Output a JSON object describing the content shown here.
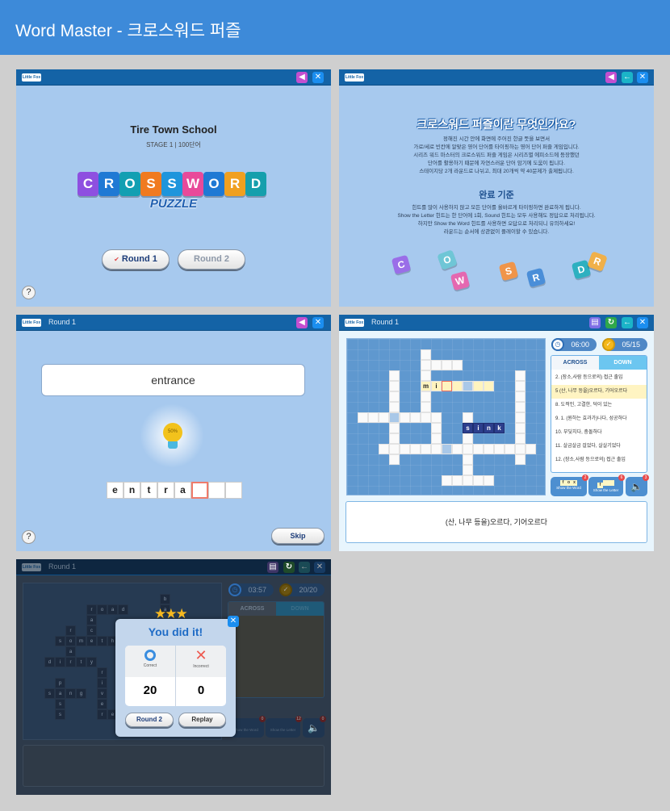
{
  "app_title": "Word Master - 크로스워드 퍼즐",
  "logo": "Little Fox",
  "colors": {
    "accent": "#3d8ad9",
    "bar": "#1463a6",
    "panel_bg": "#a7c9ee"
  },
  "intro": {
    "title": "Tire Town School",
    "stage": "STAGE 1 | 100단어",
    "logo_letters": [
      "C",
      "R",
      "O",
      "S",
      "S",
      "W",
      "O",
      "R",
      "D"
    ],
    "logo_colors": [
      "#8e4fe0",
      "#1f79d4",
      "#129fb2",
      "#f07a20",
      "#1e95dc",
      "#e84a9a",
      "#1f79d4",
      "#f0a020",
      "#159fac"
    ],
    "subtitle": "PUZZLE",
    "round1": "Round 1",
    "round2": "Round 2",
    "check": "✔",
    "help": "?"
  },
  "about": {
    "title": "크로스워드 퍼즐이란 무엇인가요?",
    "lines": [
      "정해진 시간 안에 화면에 주어진 한글 뜻을 보면서",
      "가로/세로 빈칸에 알맞은 영어 단어를 타이핑하는 영어 단어 퍼즐 게임입니다.",
      "시리즈 워드 마스터의 크로스워드 퍼즐 게임은 시리즈별 에피소드에 등장했던",
      "단어를 활용하기 때문에 자연스러운 단어 암기에 도움이 됩니다.",
      "스테이지당 2개 라운드로 나뉘고, 최대 20개씩 약 40문제가 출제됩니다."
    ],
    "title2": "완료 기준",
    "lines2": [
      "힌트를 많이 사용하지 않고 모든 단어를 올바르게 타이핑하면 완료하게 됩니다.",
      "Show the Letter 힌트는 한 단어에 1회, Sound 힌트는 모두 사용해도 정답으로 처리됩니다.",
      "하지만 Show the Word 힌트를 사용하면 오답으로 처리되니 유의하세요!",
      "라운드는 순서에 상관없이 플레이할 수 있습니다."
    ],
    "tiles": [
      "C",
      "O",
      "W",
      "S",
      "R",
      "D",
      "R"
    ]
  },
  "quiz": {
    "round": "Round 1",
    "word": "entrance",
    "hint_percent": "50%",
    "letters": [
      "e",
      "n",
      "t",
      "r",
      "a",
      "",
      "",
      ""
    ],
    "cursor_index": 5,
    "skip": "Skip",
    "help": "?"
  },
  "game": {
    "round": "Round 1",
    "time": "06:00",
    "progress": "05/15",
    "tab_across": "ACROSS",
    "tab_down": "DOWN",
    "clues": [
      "2. (장소,사람 등으로의) 접근 출입",
      "5 (산, 나무 등을)오르다, 기어오르다",
      "8. 도적인, 고결한, 덕이 있는",
      "9. 1. (원하는 효과가)나다, 성공하다",
      "10. 부딪치다, 충돌하다",
      "11. 살금살금 걸었다, 살살기었다",
      "12. (장소,사람 등으로의) 접근 출입"
    ],
    "selected_clue": 1,
    "hint_word": {
      "label": "Show the Word",
      "sample": [
        "f",
        "o",
        "x"
      ],
      "count": "2"
    },
    "hint_letter": {
      "label": "Show the Letter",
      "sample": [
        "f",
        "",
        ""
      ],
      "count": "6"
    },
    "hint_sound": {
      "count": "3"
    },
    "current_clue": "(산, 나무 등을)오르다, 기어오르다",
    "words": [
      {
        "r": 1,
        "c": 7,
        "dir": "down",
        "len": 7
      },
      {
        "r": 2,
        "c": 7,
        "dir": "across",
        "len": 4
      },
      {
        "r": 4,
        "c": 7,
        "dir": "across",
        "len": 7,
        "letters": "mi",
        "state": "active"
      },
      {
        "r": 3,
        "c": 4,
        "dir": "down",
        "len": 9
      },
      {
        "r": 7,
        "c": 1,
        "dir": "across",
        "len": 8
      },
      {
        "r": 7,
        "c": 8,
        "dir": "down",
        "len": 4
      },
      {
        "r": 8,
        "c": 11,
        "dir": "across",
        "len": 4,
        "letters": "sink",
        "state": "solved"
      },
      {
        "r": 7,
        "c": 11,
        "dir": "down",
        "len": 7
      },
      {
        "r": 10,
        "c": 3,
        "dir": "across",
        "len": 15
      },
      {
        "r": 3,
        "c": 16,
        "dir": "down",
        "len": 9
      },
      {
        "r": 13,
        "c": 9,
        "dir": "across",
        "len": 5
      }
    ],
    "cursor": {
      "r": 4,
      "c": 9
    },
    "hint_cells": [
      {
        "r": 4,
        "c": 11
      },
      {
        "r": 7,
        "c": 4
      },
      {
        "r": 10,
        "c": 9
      }
    ]
  },
  "result": {
    "round": "Round 1",
    "time": "03:57",
    "progress": "20/20",
    "tab_across": "ACROSS",
    "tab_down": "DOWN",
    "title": "You did it!",
    "correct_label": "Correct",
    "incorrect_label": "Incorrect",
    "correct": "20",
    "incorrect": "0",
    "round2": "Round 2",
    "replay": "Replay",
    "hint_word_count": "0",
    "hint_letter_count": "12",
    "hint_sound_count": "0",
    "hint_word": "Show the Word",
    "hint_letter": "Show the Letter",
    "words": [
      {
        "r": 1,
        "c": 13,
        "dir": "down",
        "text": "ba"
      },
      {
        "r": 2,
        "c": 6,
        "dir": "across",
        "text": "road"
      },
      {
        "r": 2,
        "c": 6,
        "dir": "down",
        "text": "race"
      },
      {
        "r": 4,
        "c": 4,
        "dir": "down",
        "text": "roar"
      },
      {
        "r": 5,
        "c": 3,
        "dir": "across",
        "text": "someth"
      },
      {
        "r": 7,
        "c": 2,
        "dir": "across",
        "text": "dirty"
      },
      {
        "r": 7,
        "c": 9,
        "dir": "across",
        "text": "g"
      },
      {
        "r": 8,
        "c": 7,
        "dir": "down",
        "text": "river"
      },
      {
        "r": 12,
        "c": 7,
        "dir": "across",
        "text": "re"
      },
      {
        "r": 9,
        "c": 3,
        "dir": "down",
        "text": "pass"
      },
      {
        "r": 10,
        "c": 2,
        "dir": "across",
        "text": "sang"
      }
    ]
  }
}
